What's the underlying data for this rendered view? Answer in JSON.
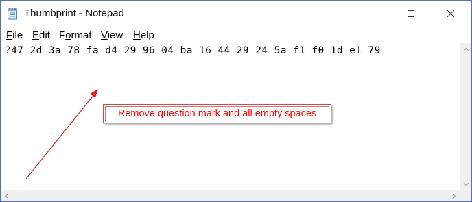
{
  "window": {
    "title": "Thumbprint - Notepad",
    "icons": {
      "app": "notepad-icon",
      "minimize": "minimize-icon",
      "maximize": "maximize-icon",
      "close": "close-icon"
    }
  },
  "menu": {
    "items": [
      {
        "label": "File",
        "accel": "F",
        "rest": "ile"
      },
      {
        "label": "Edit",
        "accel": "E",
        "rest": "dit"
      },
      {
        "label": "Format",
        "accel": "o",
        "pre": "F",
        "rest": "rmat"
      },
      {
        "label": "View",
        "accel": "V",
        "rest": "iew"
      },
      {
        "label": "Help",
        "accel": "H",
        "rest": "elp"
      }
    ]
  },
  "editor": {
    "content": "?47 2d 3a 78 fa d4 29 96 04 ba 16 44 29 24 5a f1 f0 1d e1 79"
  },
  "annotation": {
    "callout_text": "Remove question mark and all empty spaces",
    "color": "#ff0000"
  }
}
